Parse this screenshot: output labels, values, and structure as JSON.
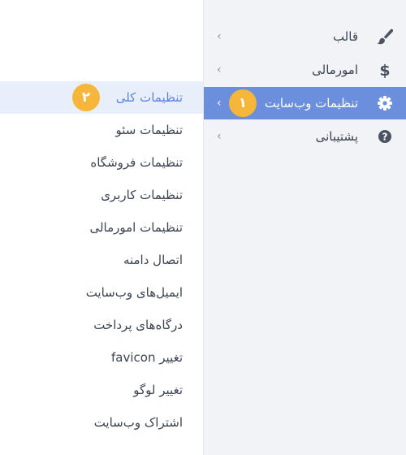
{
  "sidebar": {
    "items": [
      {
        "label": "قالب",
        "icon": "brush-icon"
      },
      {
        "label": "امورمالی",
        "icon": "dollar-icon"
      },
      {
        "label": "تنظیمات وب‌سایت",
        "icon": "gear-icon",
        "active": true,
        "badge": "۱"
      },
      {
        "label": "پشتیبانی",
        "icon": "question-circle-icon"
      }
    ],
    "chevron": "›"
  },
  "submenu": {
    "items": [
      {
        "label": "تنظیمات کلی",
        "active": true,
        "badge": "۲"
      },
      {
        "label": "تنظیمات سئو"
      },
      {
        "label": "تنظیمات فروشگاه"
      },
      {
        "label": "تنظیمات کاربری"
      },
      {
        "label": "تنظیمات امورمالی"
      },
      {
        "label": "اتصال دامنه"
      },
      {
        "label": "ایمیل‌های وب‌سایت"
      },
      {
        "label": "درگاه‌های پرداخت"
      },
      {
        "label": "تغییر favicon"
      },
      {
        "label": "تغییر لوگو"
      },
      {
        "label": "اشتراک وب‌سایت"
      }
    ]
  },
  "colors": {
    "accent": "#6b8fdc",
    "badge": "#f6b63a",
    "sidebar_bg": "#f1f3f6",
    "active_sub_bg": "#e8effb",
    "active_sub_text": "#5b84d6",
    "text": "#3b4452",
    "icon": "#4a5361"
  }
}
